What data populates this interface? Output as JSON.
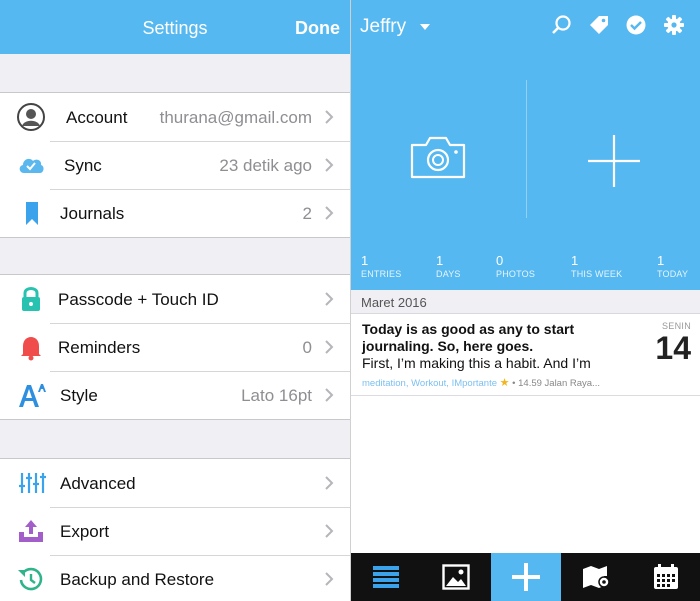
{
  "settings": {
    "title": "Settings",
    "done_label": "Done",
    "groups": [
      {
        "rows": [
          {
            "label": "Account",
            "value": "thurana@gmail.com",
            "icon": "account-icon"
          },
          {
            "label": "Sync",
            "value": "23 detik ago",
            "icon": "cloud-sync-icon"
          },
          {
            "label": "Journals",
            "value": "2",
            "icon": "bookmark-icon"
          }
        ]
      },
      {
        "rows": [
          {
            "label": "Passcode + Touch ID",
            "value": "",
            "icon": "lock-icon"
          },
          {
            "label": "Reminders",
            "value": "0",
            "icon": "bell-icon"
          },
          {
            "label": "Style",
            "value": "Lato 16pt",
            "icon": "font-style-icon"
          }
        ]
      },
      {
        "rows": [
          {
            "label": "Advanced",
            "value": "",
            "icon": "sliders-icon"
          },
          {
            "label": "Export",
            "value": "",
            "icon": "export-icon"
          },
          {
            "label": "Backup and Restore",
            "value": "",
            "icon": "restore-clock-icon"
          }
        ]
      }
    ]
  },
  "journal": {
    "name": "Jeffry",
    "top_icons": [
      "search-icon",
      "tag-icon",
      "checkmark-circle-icon",
      "gear-icon"
    ],
    "stats": [
      {
        "number": "1",
        "label": "ENTRIES"
      },
      {
        "number": "1",
        "label": "DAYS"
      },
      {
        "number": "0",
        "label": "PHOTOS"
      },
      {
        "number": "1",
        "label": "THIS WEEK"
      },
      {
        "number": "1",
        "label": "TODAY"
      }
    ],
    "month_header": "Maret 2016",
    "entry": {
      "line1": "Today is as good as any to start",
      "line2": "journaling. So, here goes.",
      "line3": "First, I’m making this a habit. And I’m",
      "tags": "meditation, Workout, IMportante",
      "meta_rest": "• 14.59 Jalan Raya...",
      "day_of_week": "SENIN",
      "day_number": "14"
    },
    "tab_icons": [
      "list-icon",
      "photos-icon",
      "add-entry-icon",
      "map-icon",
      "calendar-icon"
    ]
  },
  "colors": {
    "accent": "#56b8f0",
    "tabbar": "#111111",
    "group_bg": "#efeff4"
  }
}
